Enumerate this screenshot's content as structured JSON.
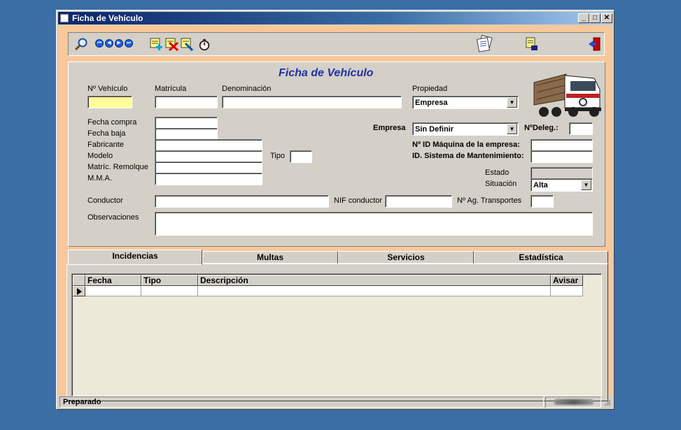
{
  "window": {
    "title": "Ficha de Vehículo",
    "minimize_label": "_",
    "maximize_label": "□",
    "close_label": "✕"
  },
  "toolbar": {
    "nav_first": "⏮",
    "nav_prev": "◀",
    "nav_next": "▶",
    "nav_last": "⏭"
  },
  "form": {
    "title": "Ficha de Vehículo",
    "labels": {
      "num_vehiculo": "Nº Vehículo",
      "matricula": "Matrícula",
      "denominacion": "Denominación",
      "propiedad": "Propiedad",
      "fecha_compra": "Fecha compra",
      "fecha_baja": "Fecha baja",
      "fabricante": "Fabricante",
      "modelo": "Modelo",
      "matric_remolque": "Matríc. Remolque",
      "mma": "M.M.A.",
      "tipo": "Tipo",
      "empresa": "Empresa",
      "num_deleg": "NºDeleg.:",
      "id_maquina": "Nº ID Máquina de la empresa:",
      "id_mantenimiento": "ID. Sistema de Mantenimiento:",
      "estado": "Estado",
      "situacion": "Situación",
      "conductor": "Conductor",
      "nif_conductor": "NIF conductor",
      "ag_transportes": "Nº Ag. Transportes",
      "observaciones": "Observaciones"
    },
    "values": {
      "propiedad": "Empresa",
      "empresa": "Sin Definir",
      "situacion": "Alta"
    }
  },
  "tabs": [
    {
      "label": "Incidencias"
    },
    {
      "label": "Multas"
    },
    {
      "label": "Servicios"
    },
    {
      "label": "Estadística"
    }
  ],
  "grid": {
    "columns": [
      "Fecha",
      "Tipo",
      "Descripción",
      "Avisar"
    ]
  },
  "status": {
    "text": "Preparado"
  },
  "colors": {
    "title_blue": "#1f2fa8",
    "frame_orange": "#f8c89a",
    "desktop": "#3a6ea5"
  }
}
